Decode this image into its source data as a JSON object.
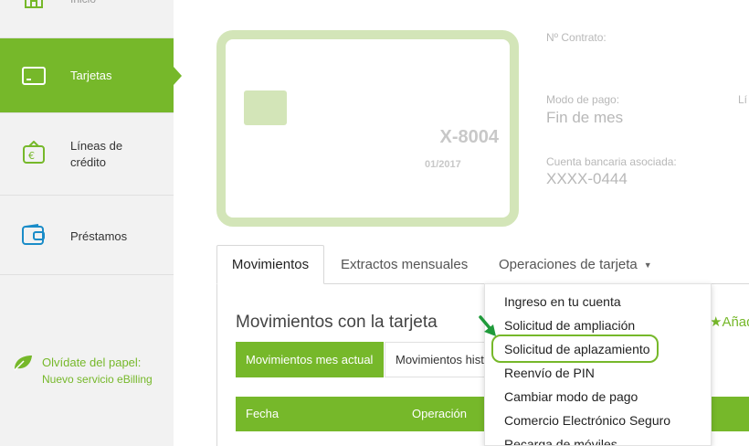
{
  "sidebar": {
    "items": [
      {
        "label": "Inicio",
        "icon": "home-icon"
      },
      {
        "label": "Tarjetas",
        "icon": "card-icon",
        "active": true
      },
      {
        "label": "Líneas de crédito",
        "icon": "credit-line-icon"
      },
      {
        "label": "Préstamos",
        "icon": "wallet-icon"
      }
    ],
    "promo": {
      "line1": "Olvídate del papel:",
      "line2": "Nuevo servicio eBilling",
      "icon": "leaf-icon"
    }
  },
  "card": {
    "number": "X-8004",
    "expiry": "01/2017"
  },
  "info": {
    "contract_label": "Nº Contrato:",
    "payment_mode_label": "Modo de pago:",
    "payment_mode_value": "Fin de mes",
    "limit_label_partial": "Lí",
    "bank_account_label": "Cuenta bancaria asociada:",
    "bank_account_value": "XXXX-0444"
  },
  "tabs": {
    "movements": "Movimientos",
    "statements": "Extractos mensuales",
    "operations": "Operaciones de tarjeta"
  },
  "section": {
    "title": "Movimientos con la tarjeta",
    "add_label": "Añad",
    "subtab_current": "Movimientos mes actual",
    "subtab_history": "Movimientos histó"
  },
  "table": {
    "headers": [
      "Fecha",
      "Operación"
    ]
  },
  "dropdown": {
    "items": [
      "Ingreso en tu cuenta",
      "Solicitud de ampliación",
      "Solicitud de aplazamiento",
      "Reenvío de PIN",
      "Cambiar modo de pago",
      "Comercio Electrónico Seguro",
      "Recarga de móviles"
    ],
    "highlighted_index": 2
  },
  "colors": {
    "accent": "#76b82a",
    "card_border": "#d3e5b8",
    "sidebar_bg": "#f2f2f2"
  }
}
